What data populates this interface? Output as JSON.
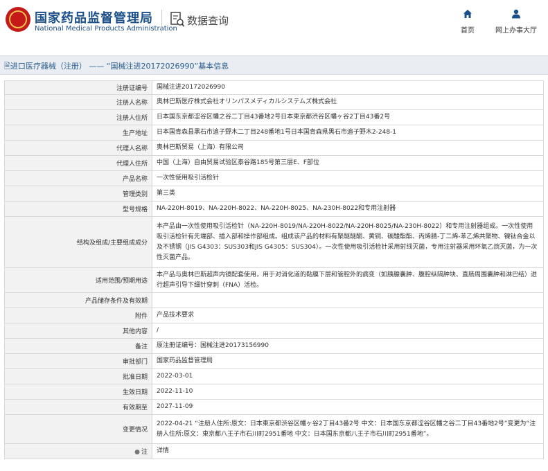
{
  "header": {
    "title": "国家药品监督管理局",
    "subtitle": "National Medical Products Administration",
    "query_label": "数据查询",
    "nav": {
      "home": "首页",
      "online": "网上办事大厅"
    }
  },
  "breadcrumb": {
    "icon": "document-icon",
    "category": "进口医疗器械（注册）",
    "separator": "——",
    "record": "“国械注进20172026990”基本信息"
  },
  "rows": [
    {
      "label": "注册证编号",
      "value": "国械注进20172026990"
    },
    {
      "label": "注册人名称",
      "value": "奥林巴斯医疗株式会社オリンパスメディカルシステムズ株式会社"
    },
    {
      "label": "注册人住所",
      "value": "日本国东京都涩谷区幡之谷二丁目43番地2号日本東京都渋谷区幡ヶ谷2丁目43番2号"
    },
    {
      "label": "生产地址",
      "value": "日本国青森县黑石市追子野木二丁目248番地1号日本国青森県黒石市追子野木2-248-1"
    },
    {
      "label": "代理人名称",
      "value": "奥林巴斯贸易（上海）有限公司"
    },
    {
      "label": "代理人住所",
      "value": "中国（上海）自由贸易试验区泰谷路185号第三层E、F部位"
    },
    {
      "label": "产品名称",
      "value": "一次性使用吸引活检针"
    },
    {
      "label": "管理类别",
      "value": "第三类"
    },
    {
      "label": "型号规格",
      "value": "NA-220H-8019、NA-220H-8022、NA-220H-8025、NA-230H-8022和专用注射器"
    },
    {
      "label": "结构及组成/主要组成成分",
      "value": "本产品由一次性使用吸引活检针（NA-220H-8019/NA-220H-8022/NA-220H-8025/NA-230H-8022）和专用注射器组成。一次性使用吸引活检针有先端部、插入部和操作部组成。组成该产品的材料有聚醚醚酮、黄铜、碳酸酯酯、丙烯腈-丁二烯-苯乙烯共聚物、镍钛合金以及不锈钢（JIS G4303：SUS303和JIS G4305：SUS304）。一次性使用吸引活检针采用射线灭菌，专用注射器采用环氧乙烷灭菌，为一次性灭菌产品。"
    },
    {
      "label": "适用范围/预期用途",
      "value": "本产品与奥林巴斯超声内镜配套使用，用于对消化道的黏膜下层和管腔外的病变（如胰腺囊肿、腹腔纵隔肿块、直肠周围囊肿和淋巴结）进行超声引导下细针穿刺（FNA）活检。"
    },
    {
      "label": "产品储存条件及有效期",
      "value": ""
    },
    {
      "label": "附件",
      "value": "产品技术要求"
    },
    {
      "label": "其他内容",
      "value": "/"
    },
    {
      "label": "备注",
      "value": "原注册证编号：国械注进20173156990"
    },
    {
      "label": "审批部门",
      "value": "国家药品监督管理局"
    },
    {
      "label": "批准日期",
      "value": "2022-03-01"
    },
    {
      "label": "生效日期",
      "value": "2022-11-10"
    },
    {
      "label": "有效期至",
      "value": "2027-11-09"
    },
    {
      "label": "变更情况",
      "value": "2022-04-21 “注册人住所:原文：日本東京都渋谷区幡ヶ谷2丁目43番2号 中文：日本国东京都涩谷区幡之谷二丁目43番地2号”变更为“注册人住所:原文：東京都八王子市石川町2951番地 中文：日本国东京都八王子市石川町2951番地”。"
    },
    {
      "label": "注",
      "value": "详情",
      "icon": "bullet-icon"
    }
  ],
  "colors": {
    "brand": "#1b4f8a",
    "emblem": "#c41a1a",
    "link": "#2a5b8f"
  }
}
